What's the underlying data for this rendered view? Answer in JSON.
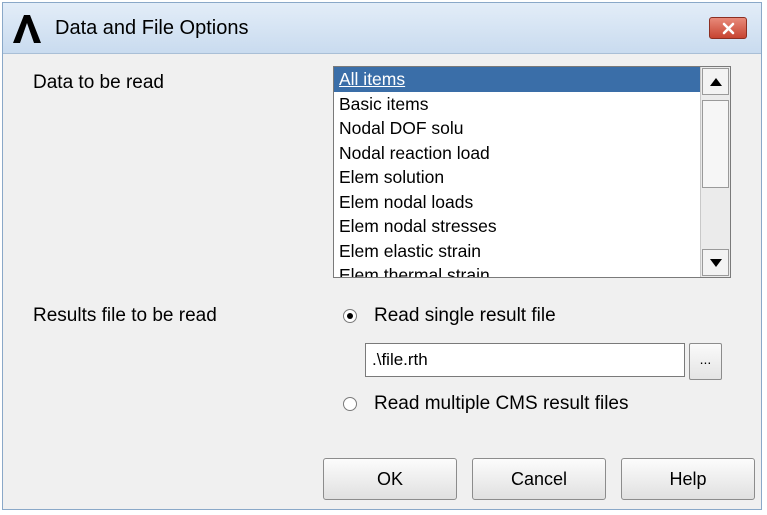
{
  "window": {
    "title": "Data and File Options"
  },
  "data_to_read": {
    "label": "Data to be read",
    "items": [
      "All items",
      "Basic items",
      "Nodal DOF solu",
      "Nodal reaction load",
      "Elem solution",
      "Elem nodal loads",
      "Elem nodal stresses",
      "Elem elastic strain",
      "Elem thermal strain"
    ],
    "selected_index": 0
  },
  "results_file": {
    "label": "Results file to be read",
    "option_single": "Read single result file",
    "option_multiple": "Read multiple CMS result files",
    "selected_option": "Read single result file",
    "file_value": ".\\file.rth",
    "browse_label": "..."
  },
  "buttons": {
    "ok": "OK",
    "cancel": "Cancel",
    "help": "Help"
  },
  "colors": {
    "selection": "#3a6ea8",
    "titlebar": "#c9dbef",
    "close_button": "#c74431",
    "dialog_bg": "#f0f0f0"
  },
  "icons": {
    "app": "ansys-logo-icon",
    "close": "close-icon",
    "scroll_up": "arrow-up-icon",
    "scroll_down": "arrow-down-icon"
  }
}
